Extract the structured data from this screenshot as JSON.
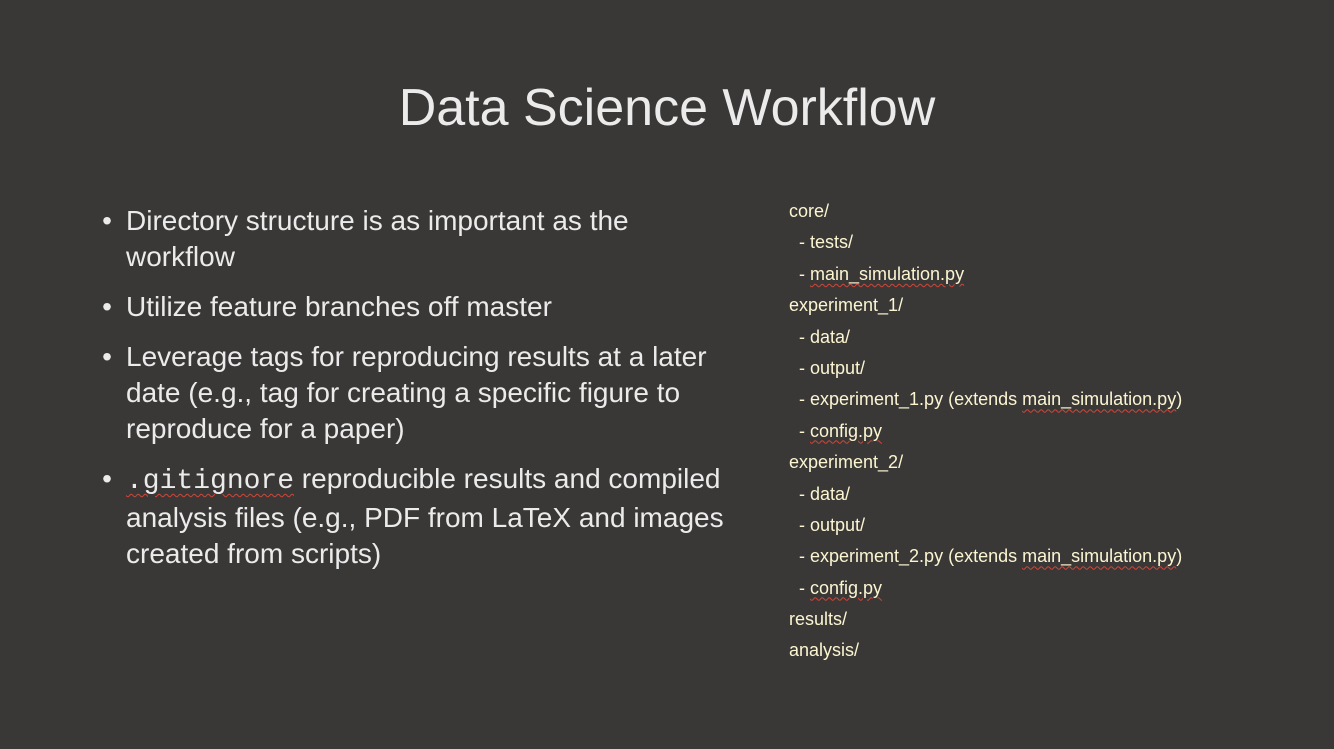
{
  "title": "Data Science Workflow",
  "bullets": {
    "b1": "Directory structure is as important as the workflow",
    "b2": "Utilize feature branches off master",
    "b3": "Leverage tags for reproducing results at a later date (e.g., tag for creating a specific figure to reproduce for a paper)",
    "b4_code": ".gitignore",
    "b4_text": " reproducible results and compiled analysis files (e.g., PDF from LaTeX and images created from scripts)"
  },
  "tree": {
    "core": "core/",
    "core_tests": "- tests/",
    "core_main_prefix": "- ",
    "core_main_file": "main_simulation.py",
    "exp1": "experiment_1/",
    "exp1_data": "- data/",
    "exp1_output": "- output/",
    "exp1_script_prefix": "- experiment_1.py (extends ",
    "exp1_script_ref": "main_simulation.py",
    "exp1_script_suffix": ")",
    "exp1_config_prefix": "- ",
    "exp1_config_file": "config.py",
    "exp2": "experiment_2/",
    "exp2_data": "- data/",
    "exp2_output": "- output/",
    "exp2_script_prefix": "- experiment_2.py (extends ",
    "exp2_script_ref": "main_simulation.py",
    "exp2_script_suffix": ")",
    "exp2_config_prefix": "- ",
    "exp2_config_file": "config.py",
    "results": "results/",
    "analysis": "analysis/"
  },
  "colors": {
    "background": "#3a3836",
    "text": "#ebebeb",
    "tree_text": "#fbf5d2",
    "spellcheck": "#d0463a"
  }
}
